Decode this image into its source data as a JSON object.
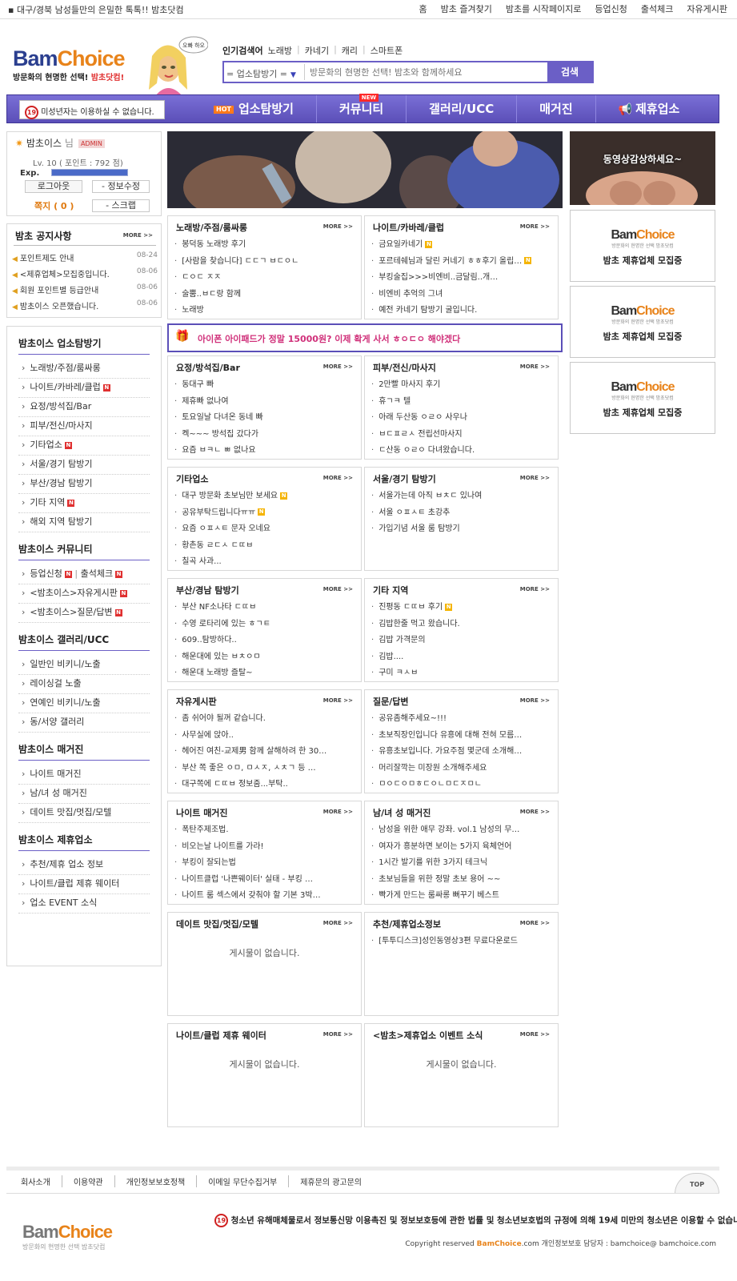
{
  "topbar": {
    "tagline": "대구/경북 남성들만의 은밀한 톡톡!! 밤초닷컴",
    "links": [
      "홈",
      "밤초 즐겨찾기",
      "밤초를 시작페이지로",
      "등업신청",
      "출석체크",
      "자유게시판"
    ]
  },
  "header": {
    "logo_prefix": "Bam",
    "logo_suffix": "Choice",
    "logo_tag": "방문화의 현명한 선택!",
    "logo_tag_accent": "밤초닷컴!",
    "mascot_bubble": "오빠 하오",
    "popular_label": "인기검색어",
    "popular_terms": [
      "노래방",
      "카네기",
      "캐리",
      "스마트폰"
    ],
    "search_select": "= 업소탐방기 =",
    "search_placeholder": "방문화의 현명한 선택! 밤초와 함께하세요",
    "search_button": "검색"
  },
  "nav": {
    "warning_badge": "19",
    "warning": "미성년자는 이용하실 수 없습니다.",
    "hot": "HOT",
    "new": "NEW",
    "items": [
      "업소탐방기",
      "커뮤니티",
      "갤러리/UCC",
      "매거진",
      "제휴업소"
    ]
  },
  "login": {
    "nickname": "밤초이스",
    "suffix": "님",
    "badge": "ADMIN",
    "level": "Lv. 10 ( 포인트 : 792 점)",
    "exp_label": "Exp.",
    "exp_fraction": 1.0,
    "logout": "로그아웃",
    "edit": "정보수정",
    "mail": "쪽지 ( 0 )",
    "scrap": "스크랩"
  },
  "notice": {
    "title": "밤초 공지사항",
    "more": "MORE >>",
    "items": [
      {
        "text": "포인트제도 안내",
        "date": "08-24"
      },
      {
        "text": "<제휴업체>모집중입니다.",
        "date": "08-06"
      },
      {
        "text": "회원 포인트별 등급안내",
        "date": "08-06"
      },
      {
        "text": "밤초이스 오픈했습니다.",
        "date": "08-06"
      }
    ]
  },
  "left_nav": [
    {
      "title": "밤초이스 업소탐방기",
      "items": [
        {
          "label": "노래방/주점/룸싸롱",
          "n": ""
        },
        {
          "label": "나이트/카바레/클럽",
          "n": "N"
        },
        {
          "label": "요정/방석집/Bar",
          "n": ""
        },
        {
          "label": "피부/전신/마사지",
          "n": ""
        },
        {
          "label": "기타업소",
          "n": "N"
        },
        {
          "label": "서울/경기 탐방기",
          "n": ""
        },
        {
          "label": "부산/경남 탐방기",
          "n": ""
        },
        {
          "label": "기타 지역",
          "n": "N"
        },
        {
          "label": "해외 지역 탐방기",
          "n": ""
        }
      ]
    },
    {
      "title": "밤초이스 커뮤니티",
      "items": [
        {
          "label": "등업신청",
          "n": "N",
          "extra": "출석체크",
          "extra_n": "N"
        },
        {
          "label": "<밤초이스>자유게시판",
          "n": "N"
        },
        {
          "label": "<밤초이스>질문/답변",
          "n": "N"
        }
      ]
    },
    {
      "title": "밤초이스 갤러리/UCC",
      "items": [
        {
          "label": "일반인 비키니/노출",
          "n": ""
        },
        {
          "label": "레이싱걸 노출",
          "n": ""
        },
        {
          "label": "연예인 비키니/노출",
          "n": ""
        },
        {
          "label": "동/서양 갤러리",
          "n": ""
        }
      ]
    },
    {
      "title": "밤초이스 매거진",
      "items": [
        {
          "label": "나이트 매거진",
          "n": ""
        },
        {
          "label": "남/녀 성 매거진",
          "n": ""
        },
        {
          "label": "데이트 맛집/멋집/모텔",
          "n": ""
        }
      ]
    },
    {
      "title": "밤초이스 제휴업소",
      "items": [
        {
          "label": "추천/제휴 업소 정보",
          "n": ""
        },
        {
          "label": "나이트/클럽 제휴 웨이터",
          "n": ""
        },
        {
          "label": "업소 EVENT 소식",
          "n": ""
        }
      ]
    }
  ],
  "mid_ad": "아이폰 아이패드가 정말 15000원? 이제 확게 사서 ㅎㅇㄷㅇ 해야겠다",
  "boards": [
    {
      "title": "노래방/주점/룸싸롱",
      "items": [
        {
          "t": "봉덕동 노래방 후기",
          "n": false
        },
        {
          "t": "[사람을 찾습니다] ㄷㄷㄱ ㅂㄷㅇㄴ",
          "n": false
        },
        {
          "t": "ㄷㅇㄷ ㅈㅈ",
          "n": false
        },
        {
          "t": "술뿜..ㅂㄷ랑 함께",
          "n": false
        },
        {
          "t": "노래방",
          "n": false
        }
      ]
    },
    {
      "title": "나이트/카바레/클럽",
      "items": [
        {
          "t": "금요일카네기",
          "n": true
        },
        {
          "t": "포르테쉐님과 달린 커네기 ㅎㅎ후기 올립…",
          "n": true
        },
        {
          "t": "부킹술집>>>비엔비..금달림..개…",
          "n": false
        },
        {
          "t": "비엔비 추억의 그녀",
          "n": false
        },
        {
          "t": "예전 카네기 탐방기 굴입니다.",
          "n": false
        }
      ]
    },
    {
      "title": "요정/방석집/Bar",
      "items": [
        {
          "t": "동대구 빠",
          "n": false
        },
        {
          "t": "제휴빠 없나여",
          "n": false
        },
        {
          "t": "토요일날 다녀온 동네 빠",
          "n": false
        },
        {
          "t": "켁~~~ 방석집 갔다가",
          "n": false
        },
        {
          "t": "요즘 ㅂㅋㄴ ㅃ 없나요",
          "n": false
        }
      ]
    },
    {
      "title": "피부/전신/마사지",
      "items": [
        {
          "t": "2만빨 마사지 후기",
          "n": false
        },
        {
          "t": "휴ㄱㅋ 텔",
          "n": false
        },
        {
          "t": "아래 두산동 ㅇㄹㅇ 사우나",
          "n": false
        },
        {
          "t": "ㅂㄷㅍㄹㅅ 전립선마사지",
          "n": false
        },
        {
          "t": "ㄷ산동 ㅇㄹㅇ 다녀왔습니다.",
          "n": false
        }
      ]
    },
    {
      "title": "기타업소",
      "items": [
        {
          "t": "대구 방문화 초보님만 보세요",
          "n": true
        },
        {
          "t": "공유부탁드립니다ㅠㅠ",
          "n": true
        },
        {
          "t": "요즘 ㅇㅍㅅㅌ 문자 오네요",
          "n": false
        },
        {
          "t": "황촌동 ㄹㄷㅅ ㄷㄸㅂ",
          "n": false
        },
        {
          "t": "칠곡 사과...",
          "n": false
        }
      ]
    },
    {
      "title": "서울/경기 탐방기",
      "items": [
        {
          "t": "서울가는데 아직 ㅂㅊㄷ 있나여",
          "n": false
        },
        {
          "t": "서울 ㅇㅍㅅㅌ 초강추",
          "n": false
        },
        {
          "t": "가입기념 서울 룸 탐방기",
          "n": false
        }
      ]
    },
    {
      "title": "부산/경남 탐방기",
      "items": [
        {
          "t": "부산 NF소나타 ㄷㄸㅂ",
          "n": false
        },
        {
          "t": "수영 로타리에 있는 ㅎㄱㅌ",
          "n": false
        },
        {
          "t": "609..탐방하다..",
          "n": false
        },
        {
          "t": "해운대에 있는 ㅂㅊㅇㅁ",
          "n": false
        },
        {
          "t": "해운대 노래방 즐탈~",
          "n": false
        }
      ]
    },
    {
      "title": "기타 지역",
      "items": [
        {
          "t": "진평동 ㄷㄸㅂ 후기",
          "n": true
        },
        {
          "t": "김밥한줄 먹고 왔습니다.",
          "n": false
        },
        {
          "t": "김밥 가격문의",
          "n": false
        },
        {
          "t": "김밥....",
          "n": false
        },
        {
          "t": "구미 ㅋㅅㅂ",
          "n": false
        }
      ]
    },
    {
      "title": "자유게시판",
      "items": [
        {
          "t": "좀 쉬어야 될꺼 같습니다.",
          "n": false
        },
        {
          "t": "사무실에 앉아..",
          "n": false
        },
        {
          "t": "헤어진 여친-교제男 함께 살해하려 한 30…",
          "n": false
        },
        {
          "t": "부산 쪽 좋은 ㅇㅁ, ㅁㅅㅈ, ㅅㅊㄱ 등 …",
          "n": false
        },
        {
          "t": "대구쪽에 ㄷㄸㅂ 정보줌...부탁..",
          "n": false
        }
      ]
    },
    {
      "title": "질문/답변",
      "items": [
        {
          "t": "공유좀해주세요~!!!",
          "n": false
        },
        {
          "t": "초보직장인입니다 유흥에 대해 전혀 모름…",
          "n": false
        },
        {
          "t": "유흥초보입니다. 가요주점 몇군데 소개해…",
          "n": false
        },
        {
          "t": "머리잘깍는 미장원 소개해주세요",
          "n": false
        },
        {
          "t": "ㅁㅇㄷㅇㅁㅎㄷㅇㄴㅁㄷㅈㅁㄴ",
          "n": false
        }
      ]
    },
    {
      "title": "나이트 매거진",
      "items": [
        {
          "t": "폭탄주제조법.",
          "n": false
        },
        {
          "t": "비오는날 나이트를 가라!",
          "n": false
        },
        {
          "t": "부킹이 잘되는법",
          "n": false
        },
        {
          "t": "나이트클럽 '나쁜웨이터' 실태 - 부킹 …",
          "n": false
        },
        {
          "t": "나이트 룸 섹스에서 갖춰야 할 기본 3박…",
          "n": false
        }
      ]
    },
    {
      "title": "남/녀 성 매거진",
      "items": [
        {
          "t": "남성을 위한 애무 강좌. vol.1 남성의 무…",
          "n": false
        },
        {
          "t": "여자가 흥분하면 보이는 5가지 육체언어",
          "n": false
        },
        {
          "t": "1시간 발기를 위한 3가지 테크닉",
          "n": false
        },
        {
          "t": "초보님들을 위한 정말 초보 용어 ~~",
          "n": false
        },
        {
          "t": "빡가게 만드는 룸싸롱 뻐꾸기 베스트",
          "n": false
        }
      ]
    },
    {
      "title": "데이트 맛집/멋집/모텔",
      "items": [],
      "empty": "게시물이 없습니다."
    },
    {
      "title": "추천/제휴업소정보",
      "items": [
        {
          "t": "[투투디스크]성인동영상3편 무료다운로드",
          "n": false
        }
      ]
    },
    {
      "title": "나이트/클럽 제휴 웨이터",
      "items": [],
      "empty": "게시물이 없습니다."
    },
    {
      "title": "<밤초>제휴업소 이벤트 소식",
      "items": [],
      "empty": "게시물이 없습니다."
    }
  ],
  "more_label": "MORE >>",
  "new_badge": "N",
  "right": {
    "video_caption": "동영상감상하세요~",
    "ad_logo_prefix": "Bam",
    "ad_logo_suffix": "Choice",
    "ad_sub": "방문화의 현명한 선택 밤초닷컴",
    "ad_caption": "밤초 제휴업체 모집중"
  },
  "footer": {
    "links": [
      "회사소개",
      "이용약관",
      "개인정보보호정책",
      "이메일 무단수집거부",
      "제휴문의 광고문의"
    ],
    "top": "TOP",
    "logo_prefix": "Bam",
    "logo_suffix": "Choice",
    "logo_tag": "방문화의 현명한 선택 밤초닷컴",
    "badge": "19",
    "legal": "청소년 유해매체물로서 정보통신망 이용촉진 및 정보보호등에 관한 법률 및 청소년보호법의 규정에 의해 19세 미만의 청소년은 이용할 수 없습니다.",
    "copy_pre": "Copyright reserved",
    "copy_brand": "BamChoice",
    "copy_post": ".com 개인정보보호 담당자 : bamchoice@ bamchoice.com"
  }
}
